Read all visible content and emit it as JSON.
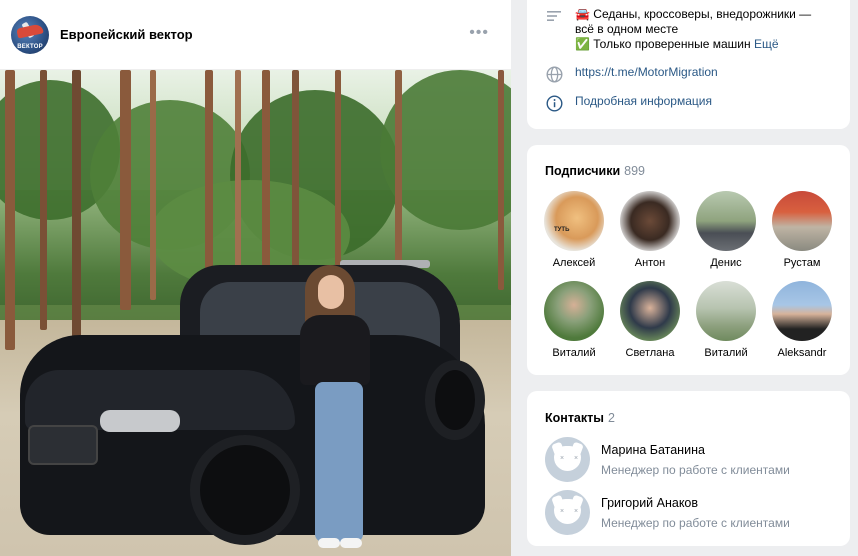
{
  "post": {
    "group_name": "Европейский вектор",
    "avatar_text": "ВЕКТОР",
    "more_label": "•••"
  },
  "info": {
    "description_line1": "🚘 Седаны, кроссоверы, внедорожники —",
    "description_line2": "всё в одном месте",
    "description_line3": "✅ Только проверенные машин",
    "more_label": "Ещё",
    "link": "https://t.me/MotorMigration",
    "details_label": "Подробная информация"
  },
  "subscribers": {
    "title": "Подписчики",
    "count": "899",
    "items": [
      {
        "name": "Алексей",
        "icon": "cat-avatar"
      },
      {
        "name": "Антон",
        "icon": "man-avatar"
      },
      {
        "name": "Денис",
        "icon": "man-avatar"
      },
      {
        "name": "Рустам",
        "icon": "bike-avatar"
      },
      {
        "name": "Виталий",
        "icon": "man-avatar"
      },
      {
        "name": "Светлана",
        "icon": "woman-avatar"
      },
      {
        "name": "Виталий",
        "icon": "landscape-avatar"
      },
      {
        "name": "Aleksandr",
        "icon": "man-avatar"
      }
    ]
  },
  "contacts": {
    "title": "Контакты",
    "count": "2",
    "items": [
      {
        "name": "Марина Батанина",
        "role": "Менеджер по работе с клиентами"
      },
      {
        "name": "Григорий Анаков",
        "role": "Менеджер по работе с клиентами"
      }
    ]
  },
  "colors": {
    "link": "#2a5885",
    "muted": "#818c99",
    "background": "#edeef0",
    "icon": "#99a2ad"
  }
}
